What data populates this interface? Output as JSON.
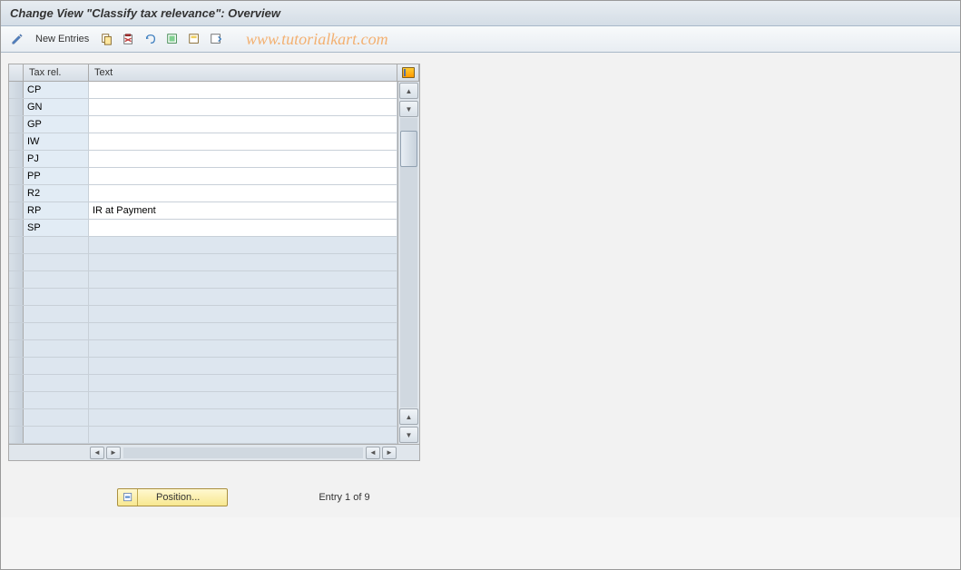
{
  "title": "Change View \"Classify tax relevance\": Overview",
  "toolbar": {
    "new_entries_label": "New Entries"
  },
  "watermark": "www.tutorialkart.com",
  "grid": {
    "headers": {
      "taxrel": "Tax rel.",
      "text": "Text"
    },
    "rows": [
      {
        "key": "CP",
        "text": ""
      },
      {
        "key": "GN",
        "text": ""
      },
      {
        "key": "GP",
        "text": ""
      },
      {
        "key": "IW",
        "text": ""
      },
      {
        "key": "PJ",
        "text": ""
      },
      {
        "key": "PP",
        "text": ""
      },
      {
        "key": "R2",
        "text": ""
      },
      {
        "key": "RP",
        "text": "IR at Payment"
      },
      {
        "key": "SP",
        "text": ""
      }
    ],
    "empty_rows": 12
  },
  "footer": {
    "position_label": "Position...",
    "entry_text": "Entry 1 of 9"
  }
}
